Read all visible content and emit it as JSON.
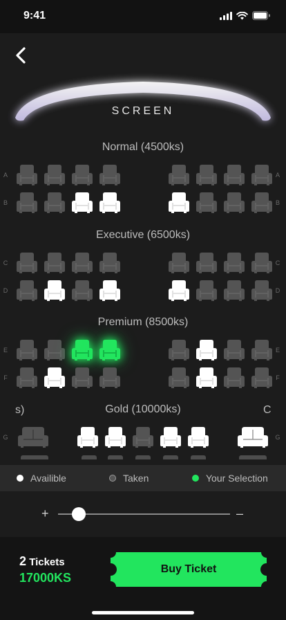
{
  "status_bar": {
    "time": "9:41"
  },
  "screen": {
    "label": "SCREEN"
  },
  "sections": {
    "normal": "Normal (4500ks)",
    "executive": "Executive (6500ks)",
    "premium": "Premium (8500ks)",
    "gold": "Gold (10000ks)"
  },
  "partial_labels": {
    "left": "s)",
    "right": "C"
  },
  "rows": {
    "A": [
      "taken",
      "taken",
      "taken",
      "taken",
      "taken",
      "taken",
      "taken",
      "taken"
    ],
    "B": [
      "taken",
      "taken",
      "available",
      "available",
      "available",
      "taken",
      "taken",
      "taken"
    ],
    "C": [
      "taken",
      "taken",
      "taken",
      "taken",
      "taken",
      "taken",
      "taken",
      "taken"
    ],
    "D": [
      "taken",
      "available",
      "taken",
      "available",
      "available",
      "taken",
      "taken",
      "taken"
    ],
    "E": [
      "taken",
      "taken",
      "selected",
      "selected",
      "taken",
      "available",
      "taken",
      "taken"
    ],
    "F": [
      "taken",
      "available",
      "taken",
      "taken",
      "taken",
      "available",
      "taken",
      "taken"
    ],
    "G": [
      "taken",
      "available",
      "available",
      "taken",
      "available",
      "available",
      "available"
    ]
  },
  "legend": {
    "available": "Availible",
    "taken": "Taken",
    "selection": "Your Selection"
  },
  "zoom": {
    "plus": "+",
    "minus": "–",
    "level": 0.12
  },
  "footer": {
    "ticket_count": "2",
    "ticket_word": "Tickets",
    "price": "17000KS",
    "buy_label": "Buy Ticket"
  },
  "colors": {
    "accent": "#22e55e",
    "taken": "#545454",
    "available": "#ffffff",
    "background": "#1c1c1c"
  }
}
